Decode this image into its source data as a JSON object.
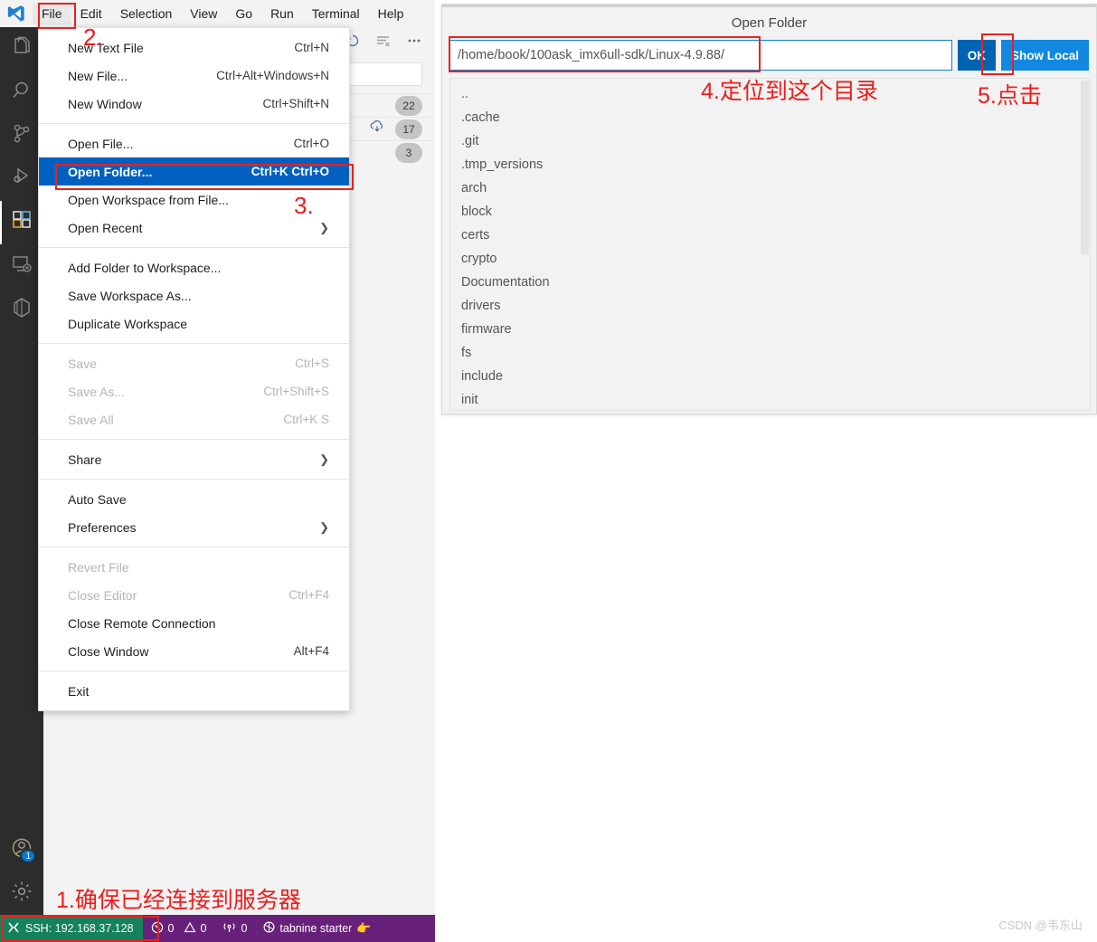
{
  "app": {
    "title": "Visual Studio Code",
    "logo_icon": "vscode-logo-icon"
  },
  "menubar": {
    "items": [
      {
        "label": "File",
        "active": true
      },
      {
        "label": "Edit",
        "active": false
      },
      {
        "label": "Selection",
        "active": false
      },
      {
        "label": "View",
        "active": false
      },
      {
        "label": "Go",
        "active": false
      },
      {
        "label": "Run",
        "active": false
      },
      {
        "label": "Terminal",
        "active": false
      },
      {
        "label": "Help",
        "active": false
      }
    ]
  },
  "activitybar": {
    "items": [
      {
        "name": "explorer",
        "icon": "files-icon"
      },
      {
        "name": "search",
        "icon": "search-icon"
      },
      {
        "name": "source-control",
        "icon": "source-control-icon"
      },
      {
        "name": "run-and-debug",
        "icon": "run-debug-icon"
      },
      {
        "name": "extensions",
        "icon": "extensions-icon"
      },
      {
        "name": "remote-explorer",
        "icon": "remote-explorer-icon"
      },
      {
        "name": "docker",
        "icon": "docker-icon"
      }
    ],
    "bottom": [
      {
        "name": "accounts",
        "icon": "account-icon",
        "badge": "1"
      },
      {
        "name": "manage",
        "icon": "gear-icon",
        "badge": ""
      }
    ]
  },
  "sidepanel": {
    "header_icons": [
      "refresh-icon",
      "discard-all-icon",
      "more-actions-icon"
    ],
    "message_placeholder": "",
    "rows": [
      {
        "badge": "22",
        "icon": ""
      },
      {
        "badge": "17",
        "icon": "cloud-download-icon"
      },
      {
        "badge": "3",
        "icon": ""
      }
    ]
  },
  "file_menu": {
    "groups": [
      [
        {
          "label": "New Text File",
          "key": "Ctrl+N",
          "state": "normal"
        },
        {
          "label": "New File...",
          "key": "Ctrl+Alt+Windows+N",
          "state": "normal"
        },
        {
          "label": "New Window",
          "key": "Ctrl+Shift+N",
          "state": "normal"
        }
      ],
      [
        {
          "label": "Open File...",
          "key": "Ctrl+O",
          "state": "normal"
        },
        {
          "label": "Open Folder...",
          "key": "Ctrl+K Ctrl+O",
          "state": "selected"
        },
        {
          "label": "Open Workspace from File...",
          "key": "",
          "state": "normal"
        },
        {
          "label": "Open Recent",
          "key": "",
          "state": "normal",
          "submenu": true
        }
      ],
      [
        {
          "label": "Add Folder to Workspace...",
          "key": "",
          "state": "normal"
        },
        {
          "label": "Save Workspace As...",
          "key": "",
          "state": "normal"
        },
        {
          "label": "Duplicate Workspace",
          "key": "",
          "state": "normal"
        }
      ],
      [
        {
          "label": "Save",
          "key": "Ctrl+S",
          "state": "disabled"
        },
        {
          "label": "Save As...",
          "key": "Ctrl+Shift+S",
          "state": "disabled"
        },
        {
          "label": "Save All",
          "key": "Ctrl+K S",
          "state": "disabled"
        }
      ],
      [
        {
          "label": "Share",
          "key": "",
          "state": "normal",
          "submenu": true
        }
      ],
      [
        {
          "label": "Auto Save",
          "key": "",
          "state": "normal"
        },
        {
          "label": "Preferences",
          "key": "",
          "state": "normal",
          "submenu": true
        }
      ],
      [
        {
          "label": "Revert File",
          "key": "",
          "state": "disabled"
        },
        {
          "label": "Close Editor",
          "key": "Ctrl+F4",
          "state": "disabled"
        },
        {
          "label": "Close Remote Connection",
          "key": "",
          "state": "normal"
        },
        {
          "label": "Close Window",
          "key": "Alt+F4",
          "state": "normal"
        }
      ],
      [
        {
          "label": "Exit",
          "key": "",
          "state": "normal"
        }
      ]
    ]
  },
  "dialog": {
    "title": "Open Folder",
    "path_value": "/home/book/100ask_imx6ull-sdk/Linux-4.9.88/",
    "path_placeholder": "",
    "ok_label": "OK",
    "show_local_label": "Show Local",
    "entries": [
      "..",
      ".cache",
      ".git",
      ".tmp_versions",
      "arch",
      "block",
      "certs",
      "crypto",
      "Documentation",
      "drivers",
      "firmware",
      "fs",
      "include",
      "init"
    ]
  },
  "statusbar": {
    "remote_label": "SSH: 192.168.37.128",
    "remote_icon": "remote-indicator-icon",
    "errors_icon": "error-icon",
    "errors_count": "0",
    "warnings_icon": "warning-icon",
    "warnings_count": "0",
    "radio_icon": "radio-tower-icon",
    "radio_count": "0",
    "tabnine_icon": "tabnine-icon",
    "tabnine_label": "tabnine starter",
    "tabnine_emoji": "pointing-hand-icon"
  },
  "annotations": {
    "step1": "1.确保已经连接到服务器",
    "step2": "2.",
    "step3": "3.",
    "step4": "4.定位到这个目录",
    "step5": "5.点击"
  },
  "watermark": {
    "text": "CSDN @韦东山"
  },
  "colors": {
    "accent_blue": "#0078d4",
    "menu_selected": "#0060c0",
    "annotation_red": "#f01c1c",
    "status_purple": "#68217a",
    "remote_green": "#16825d"
  }
}
